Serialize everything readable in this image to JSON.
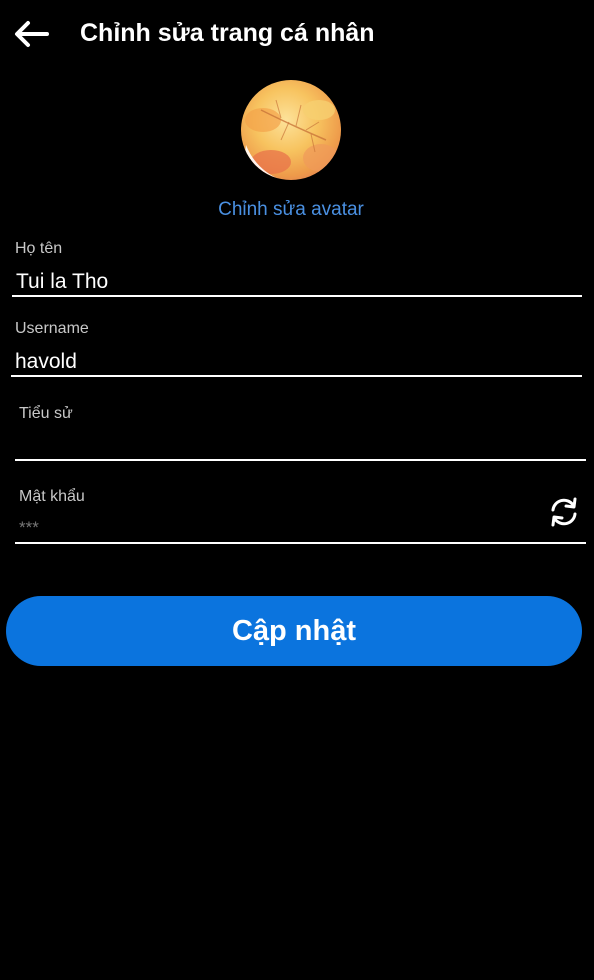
{
  "header": {
    "title": "Chỉnh sửa trang cá nhân",
    "back_icon": "arrow-left-icon"
  },
  "avatar": {
    "edit_label": "Chỉnh sửa avatar",
    "accent_color": "#4a90e2"
  },
  "form": {
    "full_name": {
      "label": "Họ tên",
      "value": "Tui la Tho"
    },
    "username": {
      "label": "Username",
      "value": "havold"
    },
    "bio": {
      "label": "Tiểu sử",
      "value": ""
    },
    "password": {
      "label": "Mật khẩu",
      "placeholder": "***",
      "refresh_icon": "refresh-icon"
    }
  },
  "actions": {
    "update_label": "Cập nhật",
    "button_color": "#0b74de"
  }
}
